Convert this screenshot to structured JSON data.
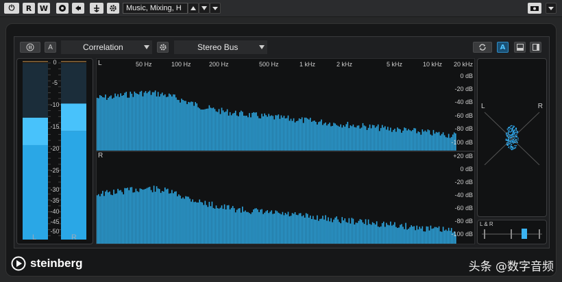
{
  "toolbar": {
    "power_label": "⏻",
    "read_label": "R",
    "write_label": "W",
    "preset_name": "Music, Mixing, H",
    "camera_icon": "camera-icon"
  },
  "header": {
    "mode_label": "Correlation",
    "bus_label": "Stereo Bus",
    "a_label": "A"
  },
  "meters": {
    "scale": [
      "0",
      "-5",
      "-10",
      "-15",
      "-20",
      "-25",
      "-30",
      "-35",
      "-40",
      "-45",
      "-50"
    ],
    "left_label": "L",
    "right_label": "R",
    "left_level": 0.69,
    "right_level": 0.77
  },
  "spectrum": {
    "freq_labels": [
      "50 Hz",
      "100 Hz",
      "200 Hz",
      "500 Hz",
      "1 kHz",
      "2 kHz",
      "5 kHz",
      "10 kHz",
      "20 kHz"
    ],
    "db_labels_top": [
      "0 dB",
      "-20 dB",
      "-40 dB",
      "-60 dB",
      "-80 dB",
      "-100 dB"
    ],
    "db_labels_bottom": [
      "+20 dB",
      "0 dB",
      "-20 dB",
      "-40 dB",
      "-60 dB",
      "-80 dB",
      "-100 dB"
    ],
    "channel_left": "L",
    "channel_right": "R"
  },
  "scope": {
    "left_label": "L",
    "right_label": "R",
    "balance_label": "L & R"
  },
  "footer": {
    "brand": "steinberg",
    "watermark": "头条 @数字音频"
  }
}
